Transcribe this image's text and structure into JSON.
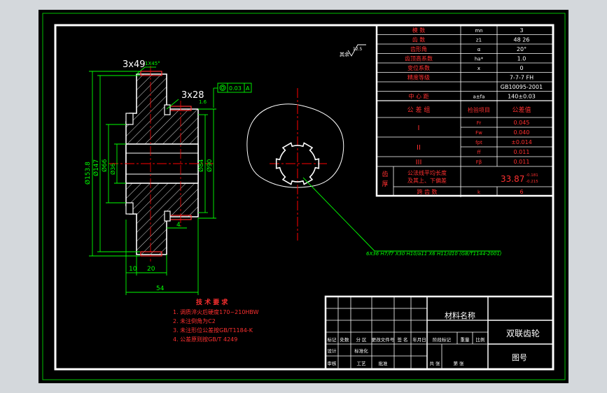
{
  "drawing": {
    "title": "双联齿轮",
    "drawing_no_label": "图号",
    "material_label": "材料名称",
    "colors": {
      "background": "#000000",
      "frame": "#ffffff",
      "outer_border": "#00c000",
      "dimension": "#00ff00",
      "centerline": "#ff0000",
      "text_red": "#ff3030",
      "hatch": "#e8e8e8",
      "gear_profile": "#ffffff"
    }
  },
  "dimensions": {
    "chamfer_top": "3x49",
    "chamfer_top_angle": "1X45°",
    "chamfer_mid": "3x28",
    "coaxiality": "0.03",
    "datum": "A",
    "roughness_mid": "1.6",
    "roughness_other": "12.5",
    "other_label": "其余",
    "d_outer": "Ø153.8",
    "d_147": "Ø147",
    "d_66": "Ø66",
    "d_spline": "Ø36",
    "d_84": "Ø84",
    "d_90": "Ø90",
    "w_10": "10",
    "w_20": "20",
    "w_54": "54",
    "w_4": "4",
    "spline_callout": "6X36 H7/f7 X30 H10/a11 X6 H11/d10 (GB/T1144-2001)"
  },
  "tech_requirements": {
    "title": "技 术 要 求",
    "items": [
      "1. 调质淬火后硬度170~210HBW",
      "2. 未注倒角为C2",
      "3. 未注形位公差按GB/T1184-K",
      "4. 公差原则按GB/T 4249"
    ]
  },
  "param_table": {
    "rows": [
      {
        "name": "模  数",
        "symbol": "mn",
        "value": "3"
      },
      {
        "name": "齿  数",
        "symbol": "z1",
        "value": "48   26"
      },
      {
        "name": "齿形角",
        "symbol": "α",
        "value": "20°"
      },
      {
        "name": "齿顶高系数",
        "symbol": "ha*",
        "value": "1.0"
      },
      {
        "name": "变位系数",
        "symbol": "x",
        "value": "0"
      },
      {
        "name": "精度等级",
        "symbol": "",
        "value": "7-7-7 FH"
      },
      {
        "name": "",
        "symbol": "",
        "value": "GB10095-2001"
      },
      {
        "name": "中 心 距",
        "symbol": "a±fa",
        "value": "140±0.03"
      }
    ],
    "tolerance_header": {
      "group": "公 差 组",
      "item": "检验项目",
      "value": "公差值"
    },
    "tolerance_rows": [
      {
        "group": "I",
        "items": [
          {
            "symbol": "Fr",
            "value": "0.045"
          },
          {
            "symbol": "Fw",
            "value": "0.040"
          }
        ]
      },
      {
        "group": "II",
        "items": [
          {
            "symbol": "fpt",
            "value": "±0.014"
          },
          {
            "symbol": "ff",
            "value": "0.011"
          }
        ]
      },
      {
        "group": "III",
        "items": [
          {
            "symbol": "Fβ",
            "value": "0.011"
          }
        ]
      }
    ],
    "thickness": {
      "label": "齿厚",
      "desc_1": "公法线平均长度",
      "desc_2": "及其上、下偏差",
      "value": "33.87",
      "upper": "-0.181",
      "lower": "-0.215",
      "span_label": "跨 齿 数",
      "span_symbol": "k",
      "span_value": "6"
    }
  },
  "title_block": {
    "row_labels_1": [
      "标记",
      "处数",
      "分 区",
      "更改文件号",
      "签 名",
      "年月日"
    ],
    "row_labels_2": [
      "设计",
      "标准化",
      "阶段标记",
      "重量",
      "比例"
    ],
    "row_labels_3": [
      "审核",
      "工艺",
      "批准",
      "共 张",
      "第 张"
    ]
  }
}
